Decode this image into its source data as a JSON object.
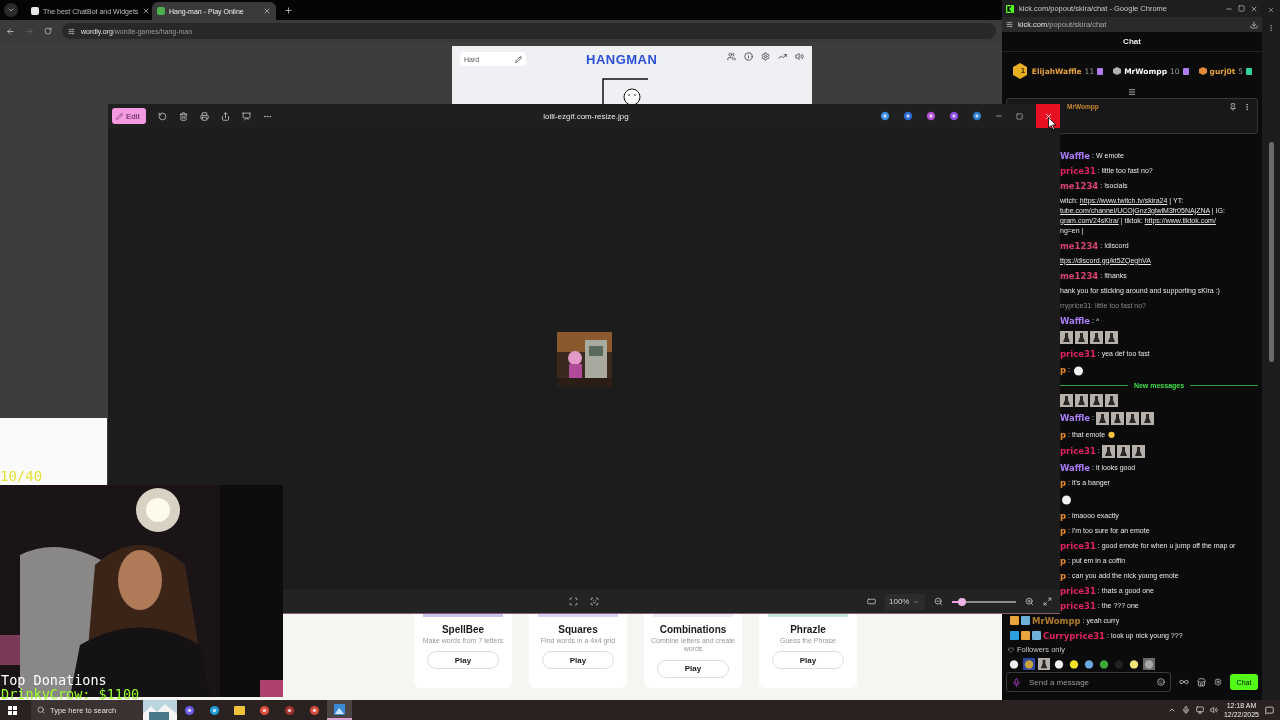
{
  "browser": {
    "tabs": [
      {
        "title": "The best ChatBot and Widgets",
        "selected": false
      },
      {
        "title": "Hang-man - Play Online",
        "selected": true
      }
    ],
    "forward_disabled": true,
    "url_host": "wordly.org",
    "url_path": "/wordle-games/hang-man",
    "hangman": {
      "difficulty": "Hard",
      "title": "HANGMAN"
    },
    "games": [
      {
        "name": "SpellBee",
        "description": "Make words from 7 letters",
        "button": "Play",
        "color": "#c9c3f0"
      },
      {
        "name": "Squares",
        "description": "Find words in a 4x4 grid",
        "button": "Play",
        "color": "#d9d4f5"
      },
      {
        "name": "Combinations",
        "description": "Combine letters and create words",
        "button": "Play",
        "color": "#ece9f8"
      },
      {
        "name": "Phrazle",
        "description": "Guess the Phrase",
        "button": "Play",
        "color": "#bfe8d8"
      }
    ]
  },
  "photos": {
    "edit": "Edit",
    "filename": "lolll-ezgif.com-resize.jpg",
    "close_hovered": true,
    "zoom": "100%",
    "zoom_slider": {
      "level": 0.15
    }
  },
  "stream_overlay": {
    "counter": "10/40",
    "donations_title": "Top Donations",
    "top_donation": "DrinkyCrow: $1100"
  },
  "chat_window": {
    "title": "kick.com/popout/skira/chat - Google Chrome",
    "url_host": "kick.com",
    "url_path": "/popout/skira/chat",
    "header": "Chat",
    "leaderboard": [
      {
        "kind": "first",
        "rank": "1",
        "name": "ElijahWaffle",
        "count": "11",
        "color": "#e8a33a",
        "gem": {
          "color": "#b07cf0"
        }
      },
      {
        "kind": "second",
        "name": "MrWompp",
        "count": "10",
        "color": "#ffffff",
        "gem": {
          "color": "#b07cf0"
        }
      },
      {
        "kind": "third",
        "name": "gurj0t",
        "count": "5",
        "color": "#e8a33a",
        "gem": {
          "color": "#34d399"
        }
      }
    ],
    "pinned": {
      "user": "MrWompp"
    },
    "messages": [
      {
        "kind": "chat",
        "user": "Waffle",
        "color": "#a97cf5",
        "text": ": W emote"
      },
      {
        "kind": "chat",
        "user": "price31",
        "color": "#e0245e",
        "text": ": little too fast no?"
      },
      {
        "kind": "chat",
        "user": "me1234",
        "color": "#d9436f",
        "text": ": !socials"
      },
      {
        "kind": "links",
        "lines": [
          [
            {
              "kind": "text",
              "text": "witch: "
            },
            {
              "kind": "link",
              "text": "https://www.twitch.tv/skira24"
            },
            {
              "kind": "text",
              "text": " | YT:"
            }
          ],
          [
            {
              "kind": "link",
              "text": "tube.com/channel/UCOjGnz3glwlM3fr05NAjZNA"
            },
            {
              "kind": "text",
              "text": " | IG:"
            }
          ],
          [
            {
              "kind": "link",
              "text": "gram.com/24sKira/"
            },
            {
              "kind": "text",
              "text": " | tiktok: "
            },
            {
              "kind": "link",
              "text": "https://www.tiktok.com/"
            }
          ],
          [
            {
              "kind": "text",
              "text": "ng=en |"
            }
          ]
        ]
      },
      {
        "kind": "chat",
        "user": "me1234",
        "color": "#d9436f",
        "text": ": !discord"
      },
      {
        "kind": "links",
        "lines": [
          [
            {
              "kind": "link",
              "text": "ttps://discord.gg/kt5ZQeghVA"
            }
          ]
        ]
      },
      {
        "kind": "chat",
        "user": "me1234",
        "color": "#d9436f",
        "text": ": !thanks"
      },
      {
        "kind": "plain",
        "text": "hank you for sticking around and supporting sKira :)"
      },
      {
        "kind": "reply",
        "text": "rryprice31: little too fast no?"
      },
      {
        "kind": "chat",
        "user": "Waffle",
        "color": "#a97cf5",
        "text": ": ^"
      },
      {
        "kind": "chat",
        "emotes": [
          {
            "kind": "figure"
          },
          {
            "kind": "figure"
          },
          {
            "kind": "figure"
          },
          {
            "kind": "figure"
          }
        ]
      },
      {
        "kind": "chat",
        "user": "price31",
        "color": "#e0245e",
        "text": ": yea def too fast"
      },
      {
        "kind": "chat",
        "user": "p",
        "color": "#e8892e",
        "text": ":",
        "emotes": [
          {
            "kind": "ghost"
          }
        ]
      },
      {
        "kind": "divider",
        "text": "New messages"
      },
      {
        "kind": "chat",
        "emotes": [
          {
            "kind": "figure"
          },
          {
            "kind": "figure"
          },
          {
            "kind": "figure"
          },
          {
            "kind": "figure"
          }
        ]
      },
      {
        "kind": "chat",
        "user": "Waffle",
        "color": "#a97cf5",
        "text": ":",
        "emotes": [
          {
            "kind": "figure"
          },
          {
            "kind": "figure"
          },
          {
            "kind": "figure"
          },
          {
            "kind": "figure"
          }
        ]
      },
      {
        "kind": "chat",
        "user": "p",
        "color": "#e8892e",
        "text": ": that emote",
        "emotes": [
          {
            "kind": "smiley"
          }
        ]
      },
      {
        "kind": "chat",
        "user": "price31",
        "color": "#e0245e",
        "text": ":",
        "emotes": [
          {
            "kind": "figure"
          },
          {
            "kind": "figure"
          },
          {
            "kind": "figure"
          }
        ]
      },
      {
        "kind": "chat",
        "user": "Waffle",
        "color": "#a97cf5",
        "text": ": it looks good"
      },
      {
        "kind": "chat",
        "user": "p",
        "color": "#e8892e",
        "text": ": it's a banger"
      },
      {
        "kind": "chat",
        "emotes": [
          {
            "kind": "ghost"
          }
        ]
      },
      {
        "kind": "chat",
        "user": "p",
        "color": "#e8892e",
        "text": ": lmaooo exactly"
      },
      {
        "kind": "chat",
        "user": "p",
        "color": "#e8892e",
        "text": ": I'm too sure for an emote"
      },
      {
        "kind": "chat",
        "user": "price31",
        "color": "#e0245e",
        "text": ": good emote for when u jump off the map or"
      },
      {
        "kind": "chat",
        "user": "p",
        "color": "#e8892e",
        "text": ": put em in a coffin"
      },
      {
        "kind": "chat",
        "user": "p",
        "color": "#e8892e",
        "text": ": can you add the nick young emote"
      },
      {
        "kind": "chat",
        "user": "price31",
        "color": "#e0245e",
        "text": ": thats a good one"
      },
      {
        "kind": "chat",
        "user": "price31",
        "color": "#e0245e",
        "text": ": the ??? one"
      },
      {
        "kind": "chat",
        "badges": [
          {
            "kind": "subscriber"
          },
          {
            "kind": "gift"
          }
        ],
        "user": "MrWompp",
        "color": "#b07a2a",
        "text": ": yeah curry"
      },
      {
        "kind": "chat",
        "badges": [
          {
            "kind": "moderator"
          },
          {
            "kind": "subscriber"
          },
          {
            "kind": "gift"
          }
        ],
        "user": "Curryprice31",
        "color": "#e0245e",
        "text": ": look up nick young ???"
      }
    ],
    "followers_only": "Followers only",
    "emote_bar": [
      {
        "kind": "ghost"
      },
      {
        "kind": "landscape"
      },
      {
        "kind": "figure"
      },
      {
        "kind": "shell"
      },
      {
        "kind": "pacman"
      },
      {
        "kind": "blob"
      },
      {
        "kind": "frog"
      },
      {
        "kind": "penguin"
      },
      {
        "kind": "duck"
      },
      {
        "kind": "cat"
      }
    ],
    "input": {
      "placeholder": "Send a message"
    },
    "send": "Chat"
  },
  "taskbar": {
    "search_placeholder": "Type here to search",
    "time": "12:18 AM",
    "date": "12/22/2025"
  }
}
